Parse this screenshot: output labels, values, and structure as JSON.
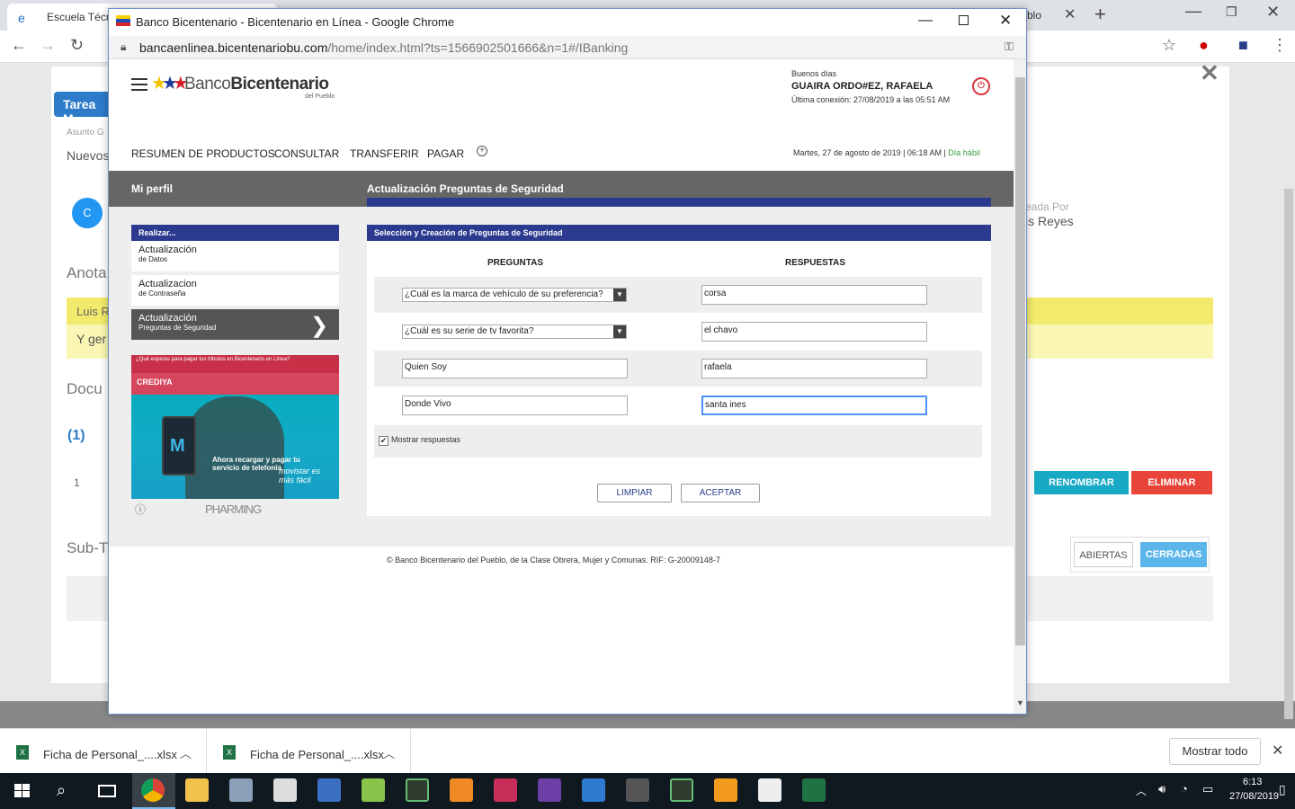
{
  "bg_browser": {
    "tab_title": "Escuela Técnica",
    "tab2_title": "blo",
    "tarea": "Tarea M",
    "asunto": "Asunto G",
    "nuevos": "Nuevos",
    "avatar_letter": "C",
    "creada_por": "eada Por",
    "creada_nombre": "is Reyes",
    "anota": "Anota",
    "luis": "Luis R",
    "y_ger": "Y ger",
    "docu": "Docu",
    "one_link": "(1)",
    "one_num": "1",
    "renombrar": "RENOMBRAR",
    "eliminar": "ELIMINAR",
    "sub": "Sub-T",
    "abiertas": "ABIERTAS",
    "cerradas": "CERRADAS"
  },
  "popup": {
    "window_title": "Banco Bicentenario - Bicentenario en Línea - Google Chrome",
    "url_host": "bancaenlinea.bicentenariobu.com",
    "url_path": "/home/index.html?ts=1566902501666&n=1#/IBanking"
  },
  "bank": {
    "logo_banco": "Banco",
    "logo_bicentenario": "Bicentenario",
    "logo_sub": "del Pueblo",
    "greeting": "Buenos días",
    "user_name": "GUAIRA ORDO#EZ, RAFAELA",
    "last_connection": "Última conexión: 27/08/2019 a las 05:51 AM",
    "nav": [
      "RESUMEN DE PRODUCTOS",
      "CONSULTAR",
      "TRANSFERIR",
      "PAGAR"
    ],
    "date_line": "Martes, 27 de agosto de 2019 | 06:18 AM | ",
    "dia_habil": "Día hábil",
    "mi_perfil": "Mi perfil",
    "section_title": "Actualización Preguntas de Seguridad",
    "side_header": "Realizar...",
    "side_items": [
      {
        "l1": "Actualización",
        "l2": "de Datos"
      },
      {
        "l1": "Actualizacion",
        "l2": "de Contraseña"
      },
      {
        "l1": "Actualización",
        "l2": "Preguntas de Seguridad"
      }
    ],
    "ad": {
      "top_text": "¿Qué esperas para pagar tus tributos en Bicentenario en Línea?",
      "credix": "CREDIYA",
      "recargar": "Ahora recargar y pagar tu servicio de telefonía",
      "movistar": "movistar es más fácil",
      "pharming": "PHARMING"
    },
    "form_header": "Selección y Creación de Preguntas de Seguridad",
    "col_preguntas": "PREGUNTAS",
    "col_respuestas": "RESPUESTAS",
    "questions": [
      {
        "question": "¿Cuál es la marca de vehículo de su preferencia?",
        "answer": "corsa"
      },
      {
        "question": "¿Cuál es su serie de tv favorita?",
        "answer": "el chavo"
      },
      {
        "question": "Quien Soy",
        "answer": "rafaela"
      },
      {
        "question": "Donde Vivo",
        "answer": "santa ines"
      }
    ],
    "show_answers": "Mostrar respuestas",
    "btn_limpiar": "LIMPIAR",
    "btn_aceptar": "ACEPTAR",
    "footer": "© Banco Bicentenario del Pueblo, de la Clase Obrera, Mujer y Comunas. RIF: G-20009148-7"
  },
  "downloads": {
    "items": [
      "Ficha de Personal_....xlsx",
      "Ficha de Personal_....xlsx"
    ],
    "show_all": "Mostrar todo"
  },
  "taskbar": {
    "time": "6:13",
    "date": "27/08/2019"
  },
  "colors": {
    "bank_navy": "#2b3a8f",
    "section_gray": "#666666",
    "chrome_frame": "#dee1e6"
  }
}
